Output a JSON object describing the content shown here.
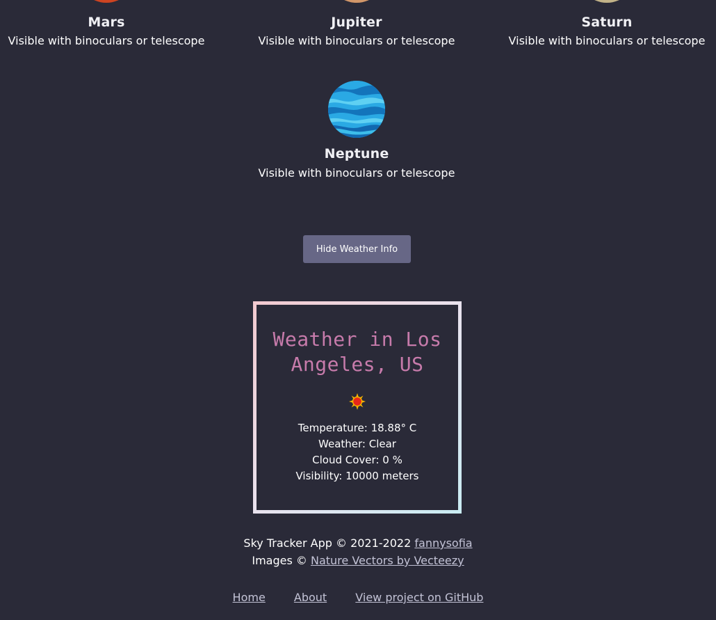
{
  "planets_top": [
    {
      "name": "Mars",
      "visibility": "Visible with binoculars or telescope",
      "color": "#e2502a"
    },
    {
      "name": "Jupiter",
      "visibility": "Visible with binoculars or telescope",
      "color": "#e0a578"
    },
    {
      "name": "Saturn",
      "visibility": "Visible with binoculars or telescope",
      "color": "#d6c79c"
    }
  ],
  "neptune": {
    "name": "Neptune",
    "visibility": "Visible with binoculars or telescope",
    "color": "#1a9fd6"
  },
  "weather_button": {
    "label": "Hide Weather Info"
  },
  "weather": {
    "title": "Weather in Los Angeles, US",
    "icon": "sun-icon",
    "temperature": "Temperature: 18.88° C",
    "condition": "Weather: Clear",
    "cloud_cover": "Cloud Cover: 0 %",
    "visibility": "Visibility: 10000 meters"
  },
  "footer": {
    "copyright_prefix": "Sky Tracker App © 2021-2022",
    "author_link": "fannysofia",
    "images_prefix": "Images ©",
    "images_link": "Nature Vectors by Vecteezy"
  },
  "nav": {
    "home": "Home",
    "about": "About",
    "github": "View project on GitHub"
  },
  "colors": {
    "background": "#2a2a38",
    "button": "#676786",
    "weather_title": "#c77bab",
    "link": "#c3c3d6"
  }
}
